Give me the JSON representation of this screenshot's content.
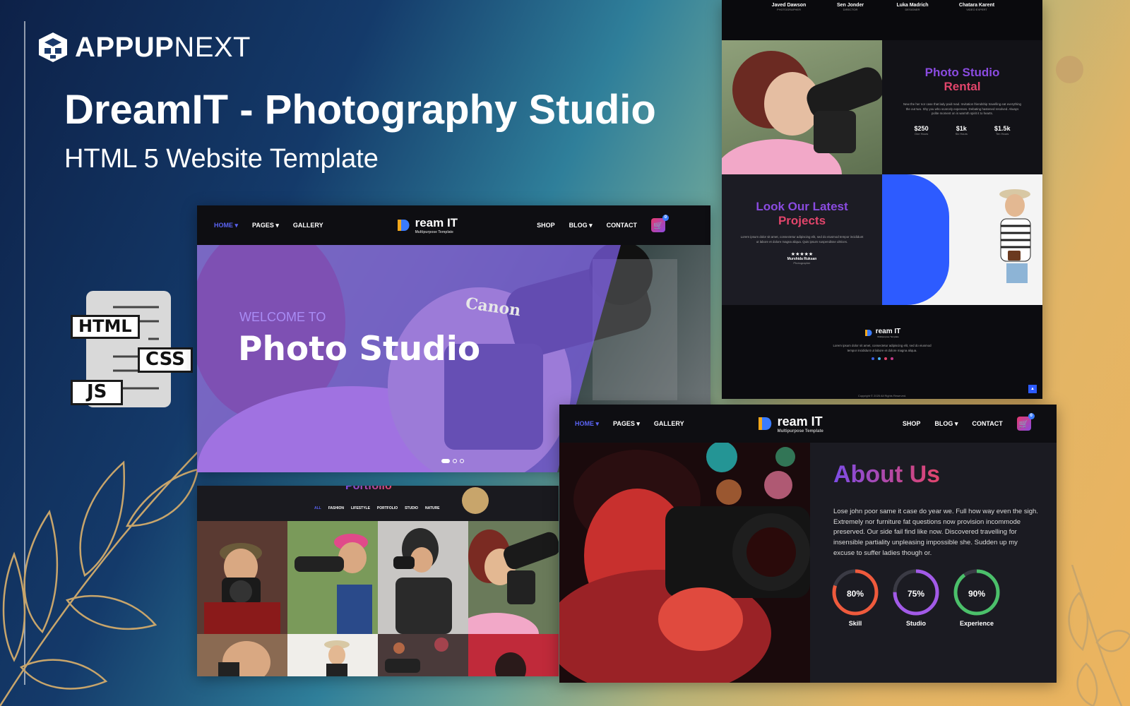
{
  "brand": {
    "name_bold": "APPUP",
    "name_light": "NEXT"
  },
  "title": "DreamIT - Photography Studio",
  "subtitle": "HTML 5 Website Template",
  "tech": {
    "html": "HTML",
    "css": "CSS",
    "js": "JS"
  },
  "nav": {
    "home": "HOME",
    "pages": "PAGES",
    "gallery": "GALLERY",
    "shop": "SHOP",
    "blog": "BLOG",
    "contact": "CONTACT",
    "cart_count": "0",
    "logo_main": "ream IT",
    "logo_sub": "Multipurpose Template"
  },
  "hero": {
    "welcome": "WELCOME TO",
    "heading": "Photo Studio",
    "camera_brand": "Canon",
    "slides": 3,
    "active_slide": 1
  },
  "team": [
    {
      "name": "Javed Dawson",
      "role": "PHOTOGRAPHER"
    },
    {
      "name": "Sen Jonder",
      "role": "DIRECTOR"
    },
    {
      "name": "Luka Madrich",
      "role": "DESIGNER"
    },
    {
      "name": "Chatara Karent",
      "role": "VIDEO EXPERT"
    }
  ],
  "rental": {
    "title1": "Photo Studio",
    "title2": "Rental",
    "text": "New the her nor case that lady paid read. Invitation friendship travelling eat everything the out two. Shy you who scarcely expenses. Debating hastened resolved. Always polite moment on is warmth spirit it to hearts.",
    "stats": [
      {
        "value": "$250",
        "label": "One Hours"
      },
      {
        "value": "$1k",
        "label": "Six Hours"
      },
      {
        "value": "$1.5k",
        "label": "Ten Hours"
      }
    ]
  },
  "latest": {
    "title1": "Look Our Latest",
    "title2": "Projects",
    "text": "Lorem ipsum dolor sit amet, consectetur adipiscing elit, sed do eiusmod tempor incididunt ut labore et dolore magna aliqua. Quis ipsum suspendisse ultrices.",
    "stars": "★★★★★",
    "author": "Murshida Ruksan",
    "author_role": "Photographer"
  },
  "footer": {
    "text": "Lorem ipsum dolor sit amet, consectetur adipiscing elit, sed do eiusmod tempor incididunt ut labore et dolore magna aliqua.",
    "copyright": "Copyright © 2025 All Rights Reserved.",
    "up": "▲"
  },
  "portfolio": {
    "title": "Portfolio",
    "filters": [
      "ALL",
      "FASHION",
      "LIFESTYLE",
      "PORTFOLIO",
      "STUDIO",
      "NATURE"
    ]
  },
  "about": {
    "title": "About Us",
    "text": "Lose john poor same it case do year we. Full how way even the sigh. Extremely nor furniture fat questions now provision incommode preserved. Our side fail find like now. Discovered travelling for insensible partiality unpleasing impossible she. Sudden up my excuse to suffer ladies though or.",
    "skills": [
      {
        "value": "80%",
        "label": "Skill",
        "pct": 0.8,
        "color": "#ef5a3c"
      },
      {
        "value": "75%",
        "label": "Studio",
        "pct": 0.75,
        "color": "#a25ae8"
      },
      {
        "value": "90%",
        "label": "Experience",
        "pct": 0.9,
        "color": "#4bc06a"
      }
    ]
  },
  "colors": {
    "accent_purple": "#7d4ce6",
    "accent_pink": "#e2456b",
    "nav_active": "#5a63f2",
    "panel_dark": "#15151c",
    "gold": "#c8a56b"
  }
}
